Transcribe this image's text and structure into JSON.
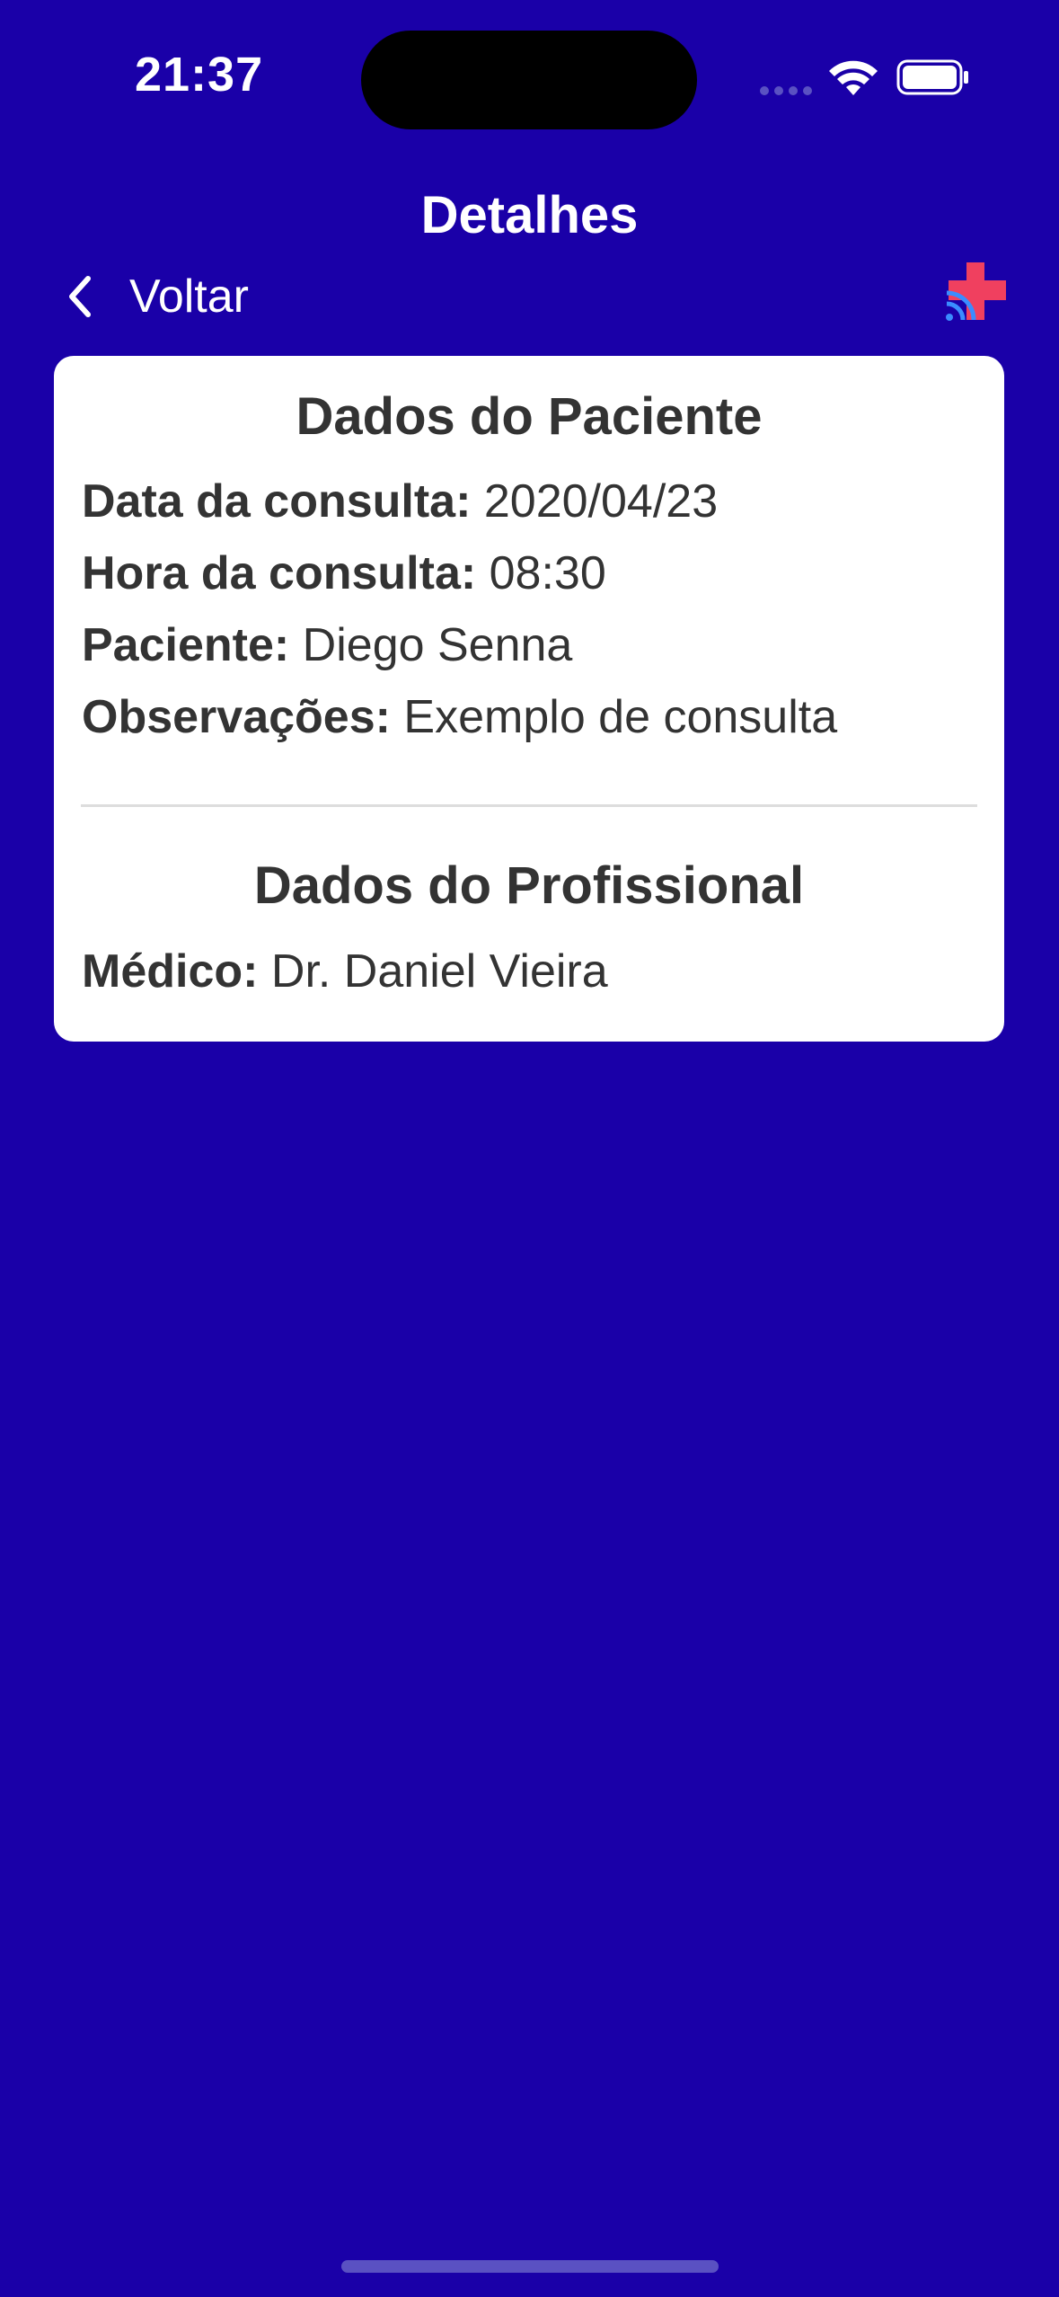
{
  "status_bar": {
    "time": "21:37",
    "icons": [
      "signal-dots-icon",
      "wifi-icon",
      "battery-icon"
    ]
  },
  "nav": {
    "title": "Detalhes",
    "back_label": "Voltar",
    "logo_icon": "medical-cross-logo-icon"
  },
  "patient": {
    "title": "Dados do Paciente",
    "rows": [
      {
        "label": "Data da consulta:",
        "value": "2020/04/23"
      },
      {
        "label": "Hora da consulta:",
        "value": "08:30"
      },
      {
        "label": "Paciente:",
        "value": "Diego Senna"
      },
      {
        "label": "Observações:",
        "value": "Exemplo de consulta"
      }
    ]
  },
  "professional": {
    "title": "Dados do Profissional",
    "rows": [
      {
        "label": "Médico:",
        "value": "Dr. Daniel Vieira"
      }
    ]
  },
  "colors": {
    "background": "#1a00a8",
    "card": "#ffffff",
    "text": "#333333",
    "logo_cross": "#f0405f",
    "logo_signal": "#3a8cff"
  }
}
